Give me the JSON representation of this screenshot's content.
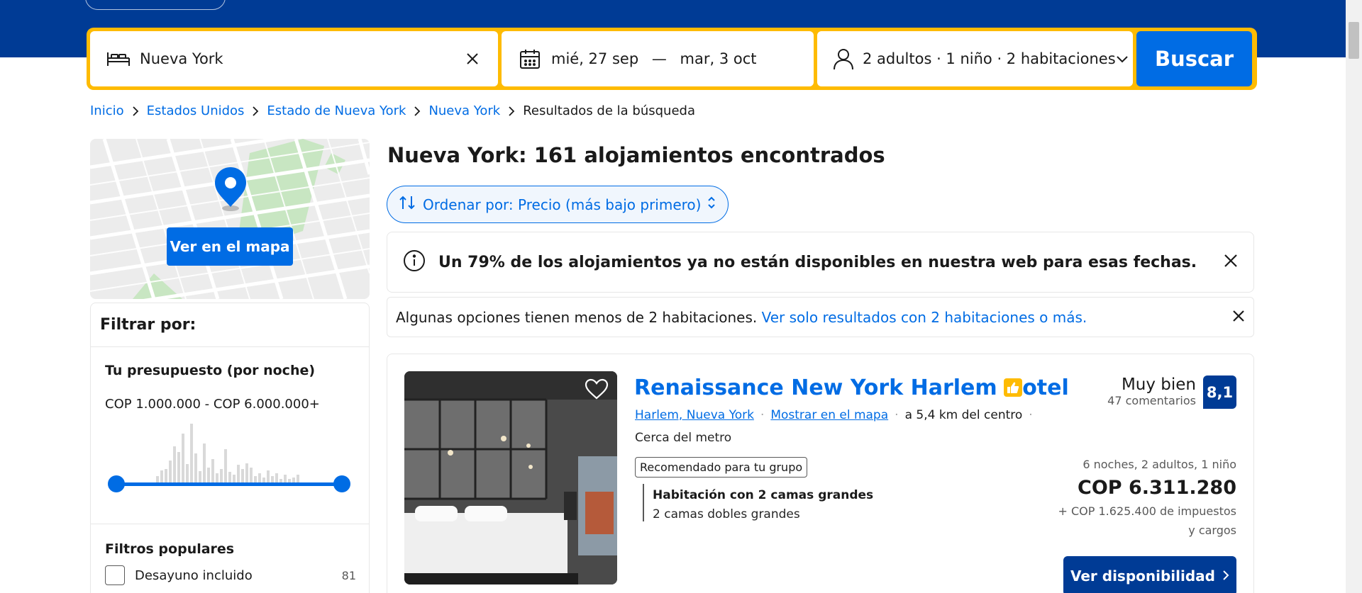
{
  "search": {
    "destination": "Nueva York",
    "dates": {
      "checkin": "mié, 27 sep",
      "separator": "—",
      "checkout": "mar, 3 oct"
    },
    "guests": "2 adultos · 1 niño · 2 habitaciones",
    "button_label": "Buscar"
  },
  "breadcrumb": [
    "Inicio",
    "Estados Unidos",
    "Estado de Nueva York",
    "Nueva York",
    "Resultados de la búsqueda"
  ],
  "map": {
    "button_label": "Ver en el mapa"
  },
  "filters": {
    "title": "Filtrar por:",
    "budget": {
      "title": "Tu presupuesto (por noche)",
      "range": "COP 1.000.000 - COP 6.000.000+",
      "slider_min_fraction": 0,
      "slider_max_fraction": 1
    },
    "popular": {
      "title": "Filtros populares",
      "items": [
        {
          "label": "Desayuno incluido",
          "count": "81"
        }
      ]
    }
  },
  "results": {
    "title": "Nueva York: 161 alojamientos encontrados",
    "sort_label": "Ordenar por: Precio (más bajo primero)"
  },
  "notices": {
    "availability": "Un 79% de los alojamientos ya no están disponibles en nuestra web para esas fechas.",
    "rooms_text": "Algunas opciones tienen menos de 2 habitaciones.",
    "rooms_link": "Ver solo resultados con 2 habitaciones o más."
  },
  "hotel": {
    "name": "Renaissance New York Harlem Hotel",
    "location": "Harlem, Nueva York",
    "map_link": "Mostrar en el mapa",
    "distance": "a 5,4 km del centro",
    "metro": "Cerca del metro",
    "badge": "Recomendado para tu grupo",
    "room_type": "Habitación con 2 camas grandes",
    "beds": "2 camas dobles grandes",
    "review_word": "Muy bien",
    "review_count": "47 comentarios",
    "score": "8,1",
    "stay": "6 noches, 2 adultos, 1 niño",
    "price": "COP 6.311.280",
    "taxes_line1": "+ COP 1.625.400 de impuestos",
    "taxes_line2": "y cargos",
    "cta": "Ver disponibilidad"
  },
  "colors": {
    "brand_blue": "#003b95",
    "action_blue": "#006ce4",
    "search_yellow": "#febb02"
  }
}
